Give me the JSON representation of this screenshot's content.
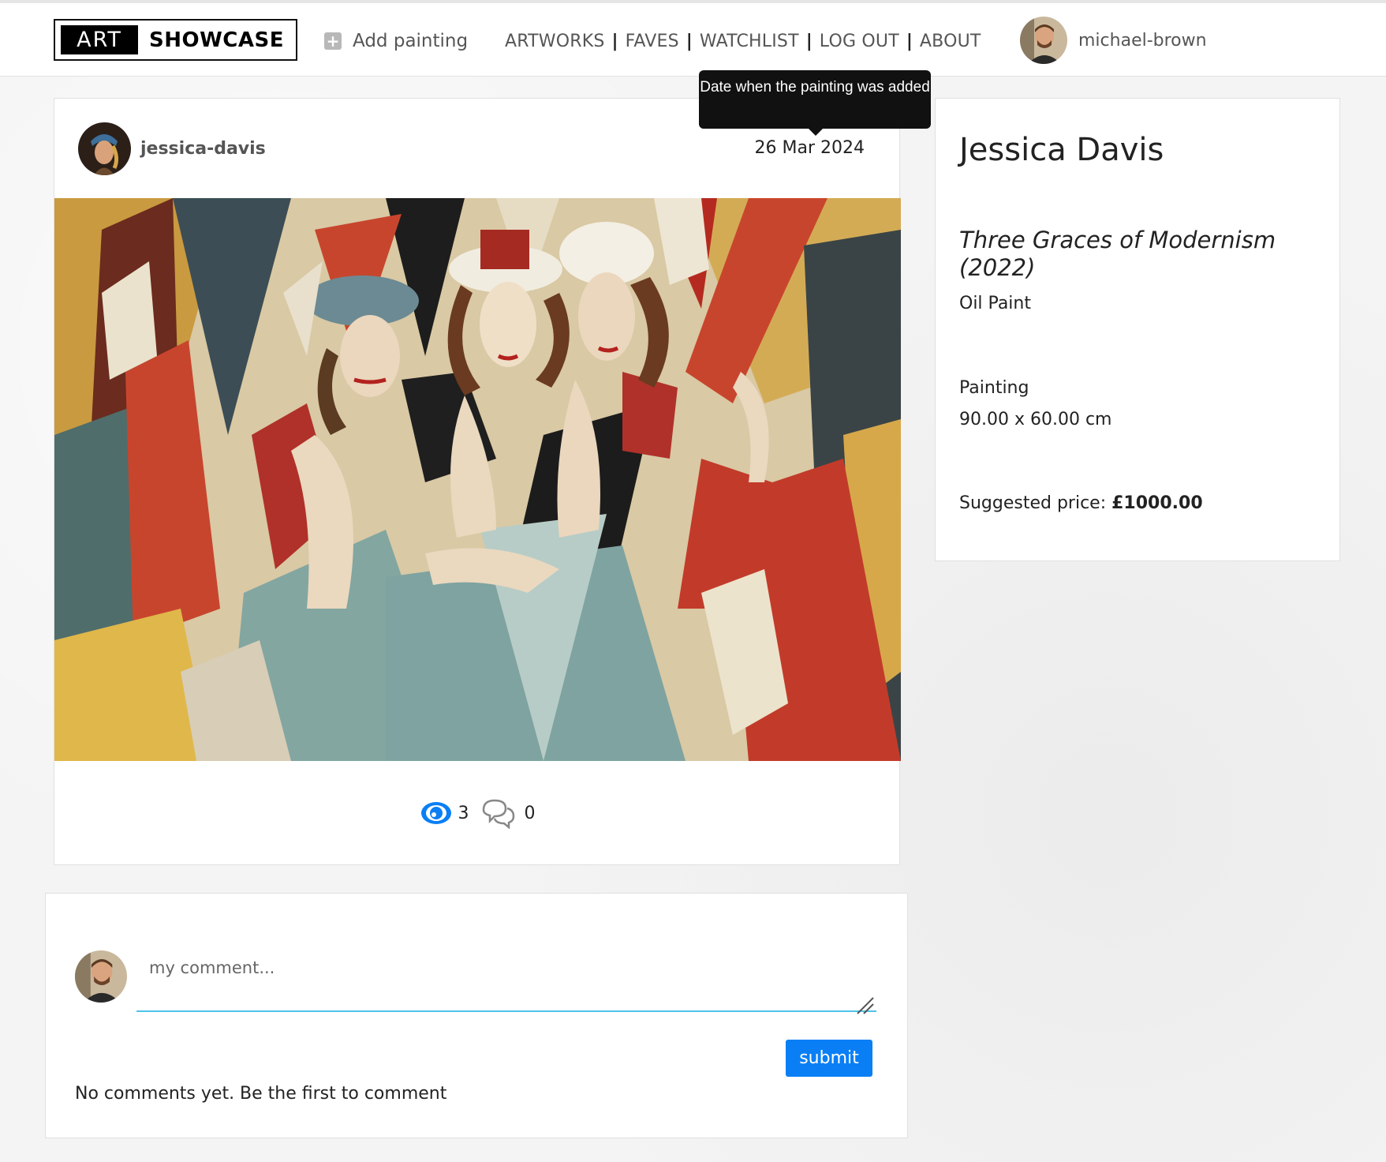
{
  "navbar": {
    "brand_art": "ART",
    "brand_showcase": "SHOWCASE",
    "add_painting": "Add painting",
    "links": [
      "ARTWORKS",
      "FAVES",
      "WATCHLIST",
      "LOG OUT",
      "ABOUT"
    ],
    "separator": "|",
    "username": "michael-brown"
  },
  "post": {
    "author": "jessica-davis",
    "date": "26 Mar 2024",
    "date_tooltip": "Date when the painting was added",
    "views": "3",
    "comments": "0"
  },
  "details": {
    "artist_name": "Jessica Davis",
    "title": "Three Graces of Modernism (2022)",
    "medium": "Oil Paint",
    "category": "Painting",
    "size": "90.00 x 60.00 cm",
    "price_label": "Suggested price:",
    "price_value": "£1000.00"
  },
  "comment_form": {
    "placeholder": "my comment...",
    "submit_label": "submit",
    "empty_message": "No comments yet. Be the first to comment"
  },
  "colors": {
    "accent": "#0a7ff5",
    "input_underline": "#4fc3e8",
    "tooltip_bg": "#111111"
  },
  "icons": [
    "plus-square-icon",
    "eye-icon",
    "comment-bubbles-icon",
    "resize-handle-icon"
  ]
}
